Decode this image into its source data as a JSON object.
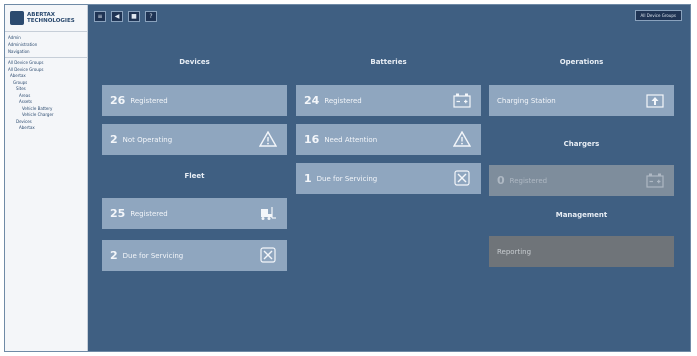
{
  "brand": {
    "name_line1": "ABERTAX",
    "name_line2": "TECHNOLOGIES"
  },
  "sidebar": {
    "top_items": [
      "Admin",
      "Administration",
      "Navigation"
    ],
    "tree_items": [
      "All Device Groups",
      "All Device Groups",
      "Abertax",
      "Groups",
      "Sites",
      "Areas",
      "Assets",
      "Vehicle Battery",
      "Vehicle Charger",
      "Devices",
      "Abertax"
    ]
  },
  "topbar": {
    "buttons": [
      "≡",
      "◀",
      "■",
      "?"
    ],
    "right_label": "All Device Groups"
  },
  "sections": {
    "devices": "Devices",
    "fleet": "Fleet",
    "batteries": "Batteries",
    "operations": "Operations",
    "chargers": "Chargers",
    "management": "Management"
  },
  "tiles": {
    "devices_registered": {
      "num": "26",
      "label": "Registered"
    },
    "devices_not_operating": {
      "num": "2",
      "label": "Not Operating"
    },
    "fleet_registered": {
      "num": "25",
      "label": "Registered"
    },
    "fleet_due_servicing": {
      "num": "2",
      "label": "Due for Servicing"
    },
    "batteries_registered": {
      "num": "24",
      "label": "Registered"
    },
    "batteries_need_attention": {
      "num": "16",
      "label": "Need Attention"
    },
    "batteries_due_servicing": {
      "num": "1",
      "label": "Due for Servicing"
    },
    "operations_charging_station": {
      "label": "Charging Station"
    },
    "chargers_registered": {
      "num": "0",
      "label": "Registered"
    },
    "management_reporting": {
      "label": "Reporting"
    }
  }
}
